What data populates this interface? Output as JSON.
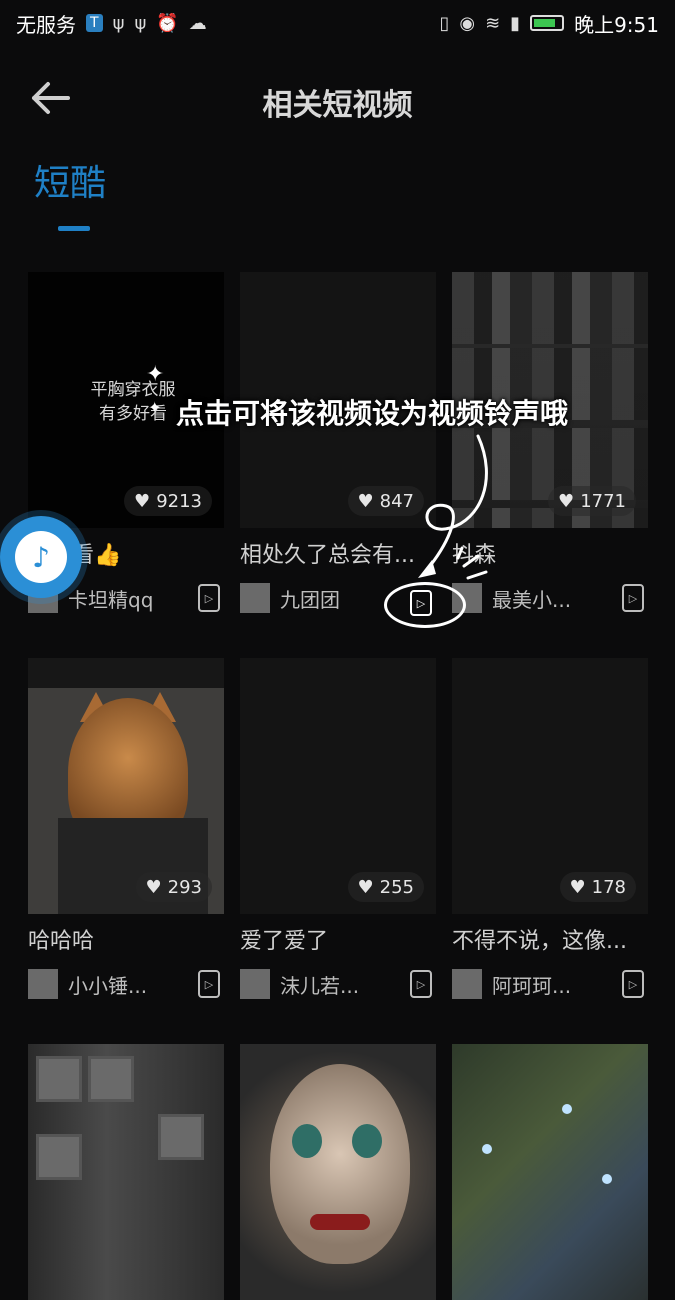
{
  "status_bar": {
    "carrier": "无服务",
    "time": "晚上9:51"
  },
  "header": {
    "title": "相关短视频"
  },
  "tabs": [
    {
      "label": "短酷",
      "active": true
    }
  ],
  "videos": [
    {
      "likes": "9213",
      "title": "都好看👍",
      "author": "卡坦精qq",
      "caption": "平胸穿衣服\n有多好看"
    },
    {
      "likes": "847",
      "title": "相处久了总会有...",
      "author": "九团团"
    },
    {
      "likes": "1771",
      "title": "抖森",
      "author": "最美小..."
    },
    {
      "likes": "293",
      "title": "哈哈哈",
      "author": "小小锤..."
    },
    {
      "likes": "255",
      "title": "爱了爱了",
      "author": "沫儿若..."
    },
    {
      "likes": "178",
      "title": "不得不说，这像...",
      "author": "阿珂珂..."
    }
  ],
  "tooltip": {
    "text": "点击可将该视频设为视频铃声哦"
  },
  "colors": {
    "accent": "#1f80c6",
    "background": "#0b0b0c"
  },
  "icons": {
    "back": "arrow-left-icon",
    "like": "heart-icon",
    "ringtone": "video-ringtone-icon",
    "music": "music-note-icon"
  }
}
